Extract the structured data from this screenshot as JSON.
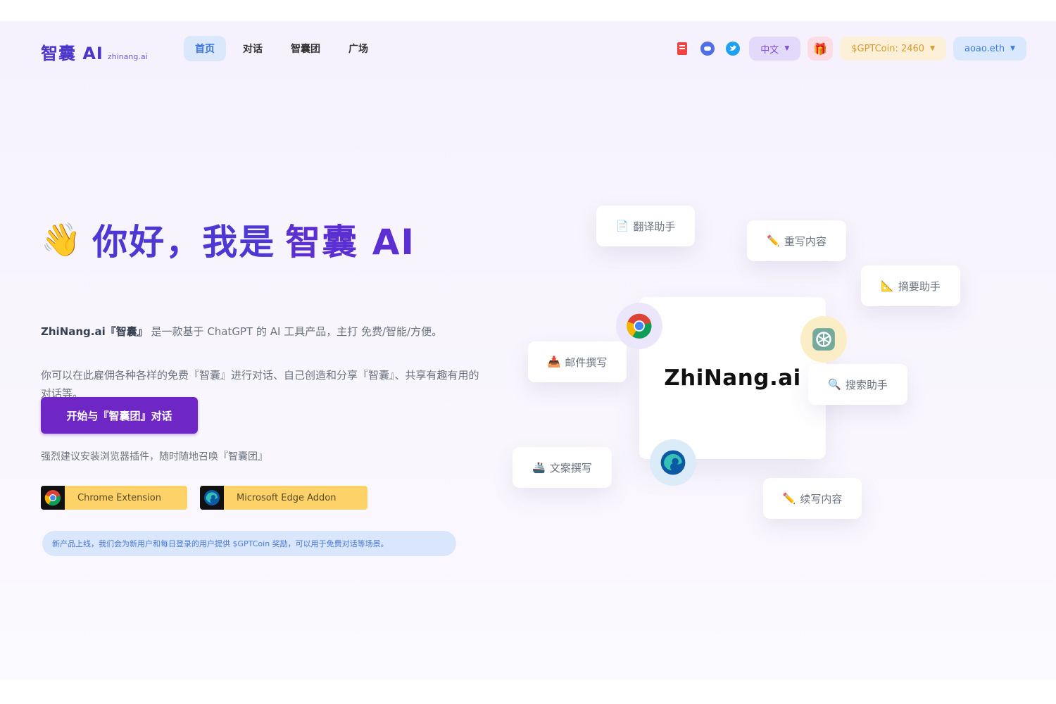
{
  "header": {
    "logo_main": "智囊 AI",
    "logo_sub": "zhinang.ai",
    "tabs": [
      {
        "label": "首页",
        "active": true
      },
      {
        "label": "对话",
        "active": false
      },
      {
        "label": "智囊团",
        "active": false
      },
      {
        "label": "广场",
        "active": false
      }
    ],
    "icons": [
      "notebook-icon",
      "chat-bubble-icon",
      "twitter-icon"
    ],
    "language": "中文",
    "gift_icon": "gift-icon",
    "coin": "$GPTCoin: 2460",
    "user": "aoao.eth"
  },
  "hero": {
    "wave": "👋",
    "title_prefix": "你好，我是",
    "title_name": "智囊 AI",
    "desc1_strong": "ZhiNang.ai『智囊』",
    "desc1_rest": "是一款基于 ChatGPT 的 AI 工具产品，主打 免费/智能/方便。",
    "desc2": "你可以在此雇佣各种各样的免费『智囊』进行对话、自己创造和分享『智囊』、共享有趣有用的对话等。",
    "cta": "开始与『智囊团』对话",
    "hint": "强烈建议安装浏览器插件，随时随地召唤『智囊团』",
    "chrome_ext": "Chrome Extension",
    "edge_ext": "Microsoft Edge Addon",
    "notice": "新产品上线，我们会为新用户和每日登录的用户提供 $GPTCoin 奖励，可以用于免费对话等场景。"
  },
  "illustration": {
    "brand": "ZhiNang.ai",
    "chips": [
      {
        "icon": "📄",
        "label": "翻译助手"
      },
      {
        "icon": "✏️",
        "label": "重写内容"
      },
      {
        "icon": "📐",
        "label": "摘要助手"
      },
      {
        "icon": "📥",
        "label": "邮件撰写"
      },
      {
        "icon": "🔍",
        "label": "搜索助手"
      },
      {
        "icon": "🚢",
        "label": "文案撰写"
      },
      {
        "icon": "✏️",
        "label": "续写内容"
      }
    ],
    "badges": [
      "chrome-icon",
      "openai-icon",
      "edge-icon"
    ]
  }
}
